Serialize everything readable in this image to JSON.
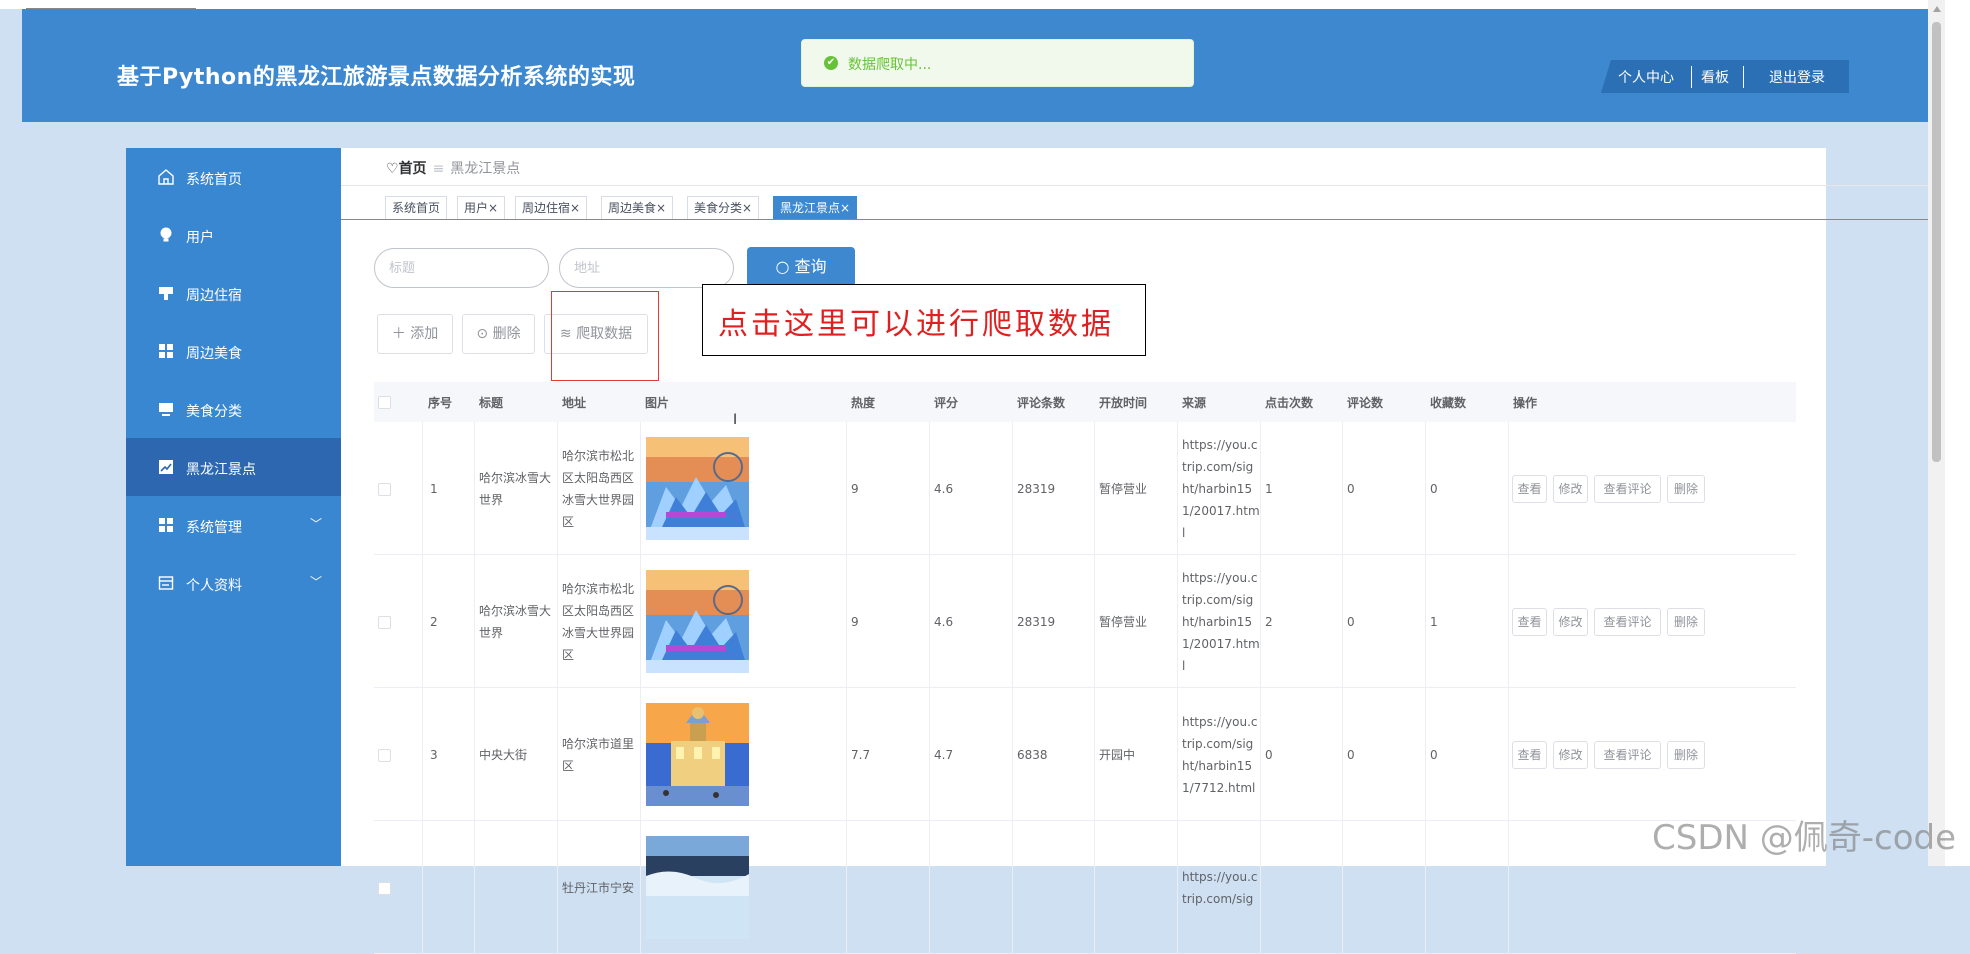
{
  "header": {
    "title": "基于Python的黑龙江旅游景点数据分析系统的实现",
    "toast": "数据爬取中...",
    "actions": [
      "个人中心",
      "看板",
      "退出登录"
    ]
  },
  "sidebar": {
    "items": [
      {
        "label": "系统首页",
        "icon": "home-icon"
      },
      {
        "label": "用户",
        "icon": "bulb-icon"
      },
      {
        "label": "周边住宿",
        "icon": "ticket-icon"
      },
      {
        "label": "周边美食",
        "icon": "grid-icon"
      },
      {
        "label": "美食分类",
        "icon": "monitor-icon"
      },
      {
        "label": "黑龙江景点",
        "icon": "chart-icon"
      },
      {
        "label": "系统管理",
        "icon": "grid-icon"
      },
      {
        "label": "个人资料",
        "icon": "document-icon"
      }
    ]
  },
  "breadcrumb": {
    "home": "首页",
    "current": "黑龙江景点"
  },
  "tabs": [
    "系统首页",
    "用户×",
    "周边住宿×",
    "周边美食×",
    "美食分类×",
    "黑龙江景点×"
  ],
  "search": {
    "title_placeholder": "标题",
    "address_placeholder": "地址",
    "query_label": "查询"
  },
  "toolbar": {
    "add_label": "添加",
    "delete_label": "删除",
    "crawl_label": "爬取数据"
  },
  "callout": "点击这里可以进行爬取数据",
  "table": {
    "headers": [
      "序号",
      "标题",
      "地址",
      "图片",
      "热度",
      "评分",
      "评论条数",
      "开放时间",
      "来源",
      "点击次数",
      "评论数",
      "收藏数",
      "操作"
    ],
    "row_actions": [
      "查看",
      "修改",
      "查看评论",
      "删除"
    ],
    "rows": [
      {
        "no": "1",
        "title": [
          "哈尔滨冰雪大",
          "世界"
        ],
        "address": [
          "哈尔滨市松北",
          "区太阳岛西区",
          "冰雪大世界园",
          "区"
        ],
        "heat": "9",
        "score": "4.6",
        "comments": "28319",
        "open": "暂停营业",
        "source": [
          "https://you.c",
          "trip.com/sig",
          "ht/harbin15",
          "1/20017.htm",
          "l"
        ],
        "clicks": "1",
        "reviews": "0",
        "favorites": "0"
      },
      {
        "no": "2",
        "title": [
          "哈尔滨冰雪大",
          "世界"
        ],
        "address": [
          "哈尔滨市松北",
          "区太阳岛西区",
          "冰雪大世界园",
          "区"
        ],
        "heat": "9",
        "score": "4.6",
        "comments": "28319",
        "open": "暂停营业",
        "source": [
          "https://you.c",
          "trip.com/sig",
          "ht/harbin15",
          "1/20017.htm",
          "l"
        ],
        "clicks": "2",
        "reviews": "0",
        "favorites": "1"
      },
      {
        "no": "3",
        "title": [
          "中央大街"
        ],
        "address": [
          "哈尔滨市道里",
          "区"
        ],
        "heat": "7.7",
        "score": "4.7",
        "comments": "6838",
        "open": "开园中",
        "source": [
          "https://you.c",
          "trip.com/sig",
          "ht/harbin15",
          "1/7712.html"
        ],
        "clicks": "0",
        "reviews": "0",
        "favorites": "0"
      },
      {
        "no": "",
        "title": [],
        "address": [
          "牡丹江市宁安"
        ],
        "heat": "",
        "score": "",
        "comments": "",
        "open": "",
        "source": [
          "https://you.c",
          "trip.com/sig"
        ],
        "clicks": "",
        "reviews": "",
        "favorites": ""
      }
    ]
  },
  "watermark": "CSDN @佩奇-code",
  "colors": {
    "primary": "#3d88cf",
    "sidebar_active": "#2c67b0",
    "success": "#67c23a",
    "callout": "#e02020"
  }
}
